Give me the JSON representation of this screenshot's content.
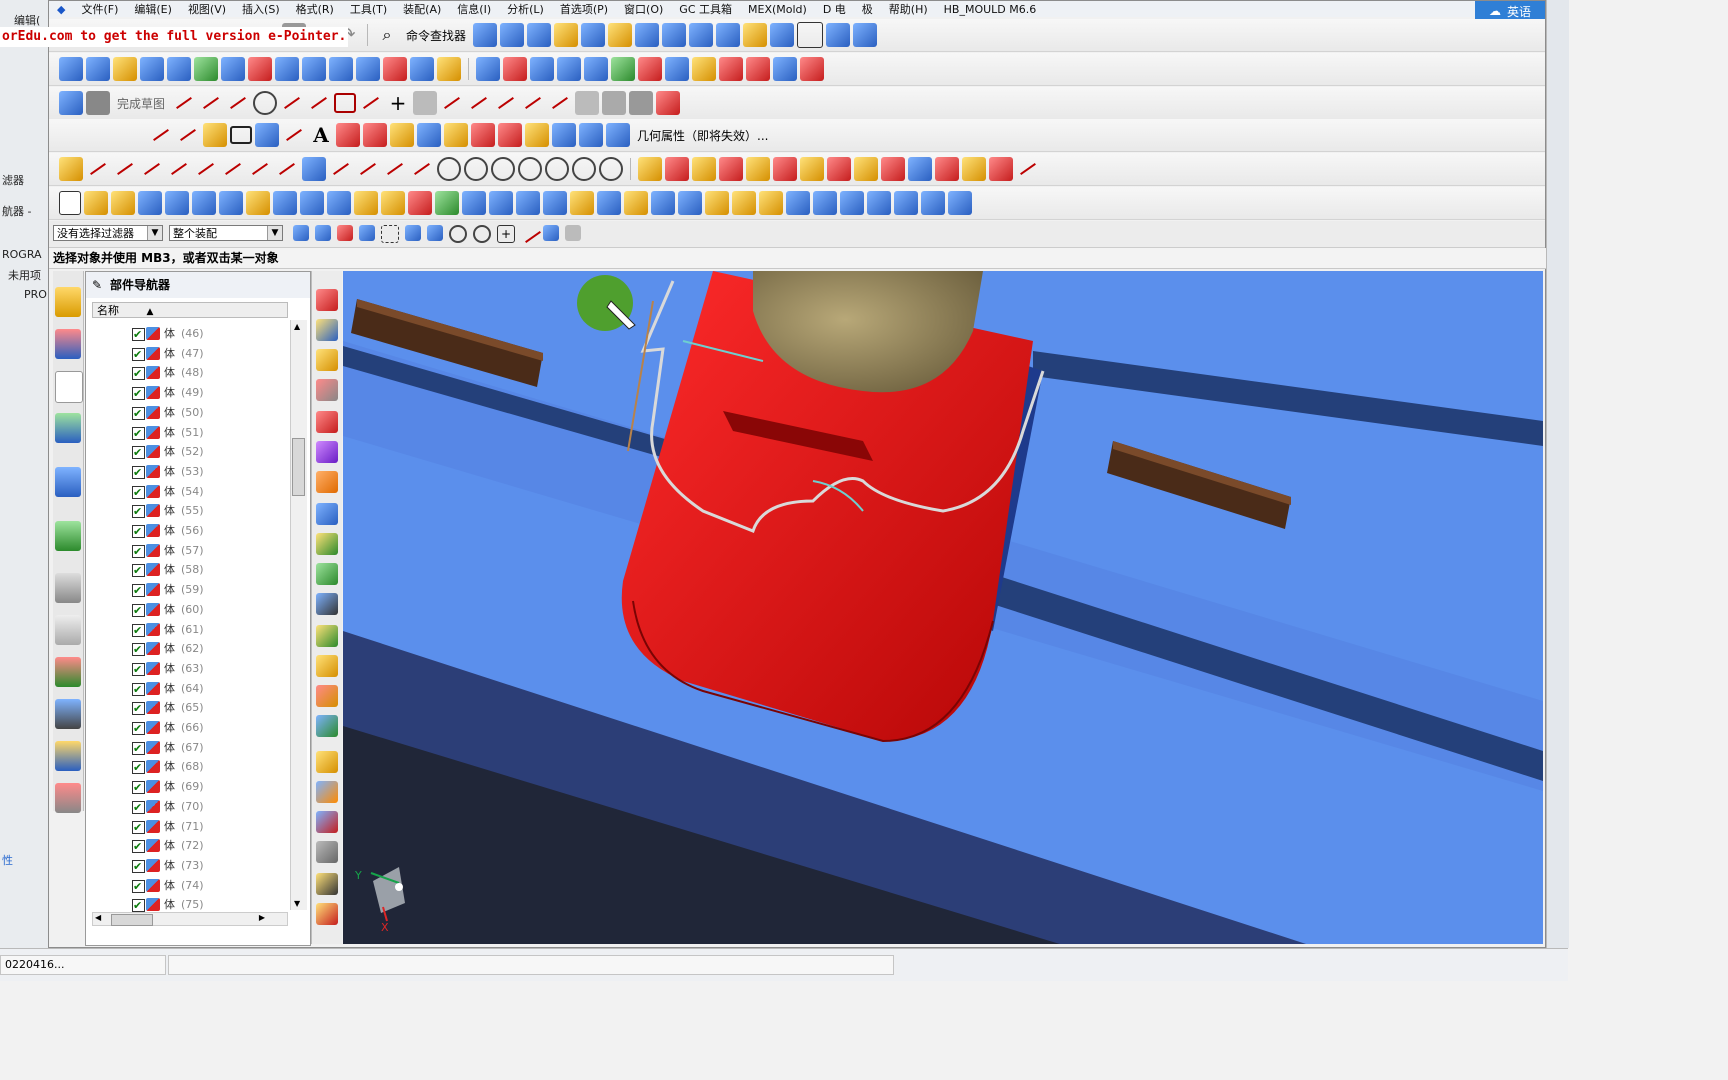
{
  "watermark": "orEdu.com to get the full version e-Pointer.",
  "bg_app": {
    "menu_fragment": "编辑(",
    "filter_fragment": "滤器",
    "nav_fragment": "航器 -",
    "program_fragment": "ROGRA",
    "unused_fragment": "未用项",
    "pro_fragment": "PRO",
    "prop_fragment": "性",
    "time_fragment": "0220416..."
  },
  "menubar": {
    "items": [
      "文件(F)",
      "编辑(E)",
      "视图(V)",
      "插入(S)",
      "格式(R)",
      "工具(T)",
      "装配(A)",
      "信息(I)",
      "分析(L)",
      "首选项(P)",
      "窗口(O)",
      "GC 工具箱",
      "MEX(Mold)",
      "D 电",
      "极",
      "帮助(H)",
      "HB_MOULD M6.6"
    ]
  },
  "cloud": {
    "label": "英语"
  },
  "toolbar": {
    "command_finder": "命令查找器",
    "finish_sketch": "完成草图",
    "geometry_props": "几何属性（即将失效）..."
  },
  "filter": {
    "selection_filter": "没有选择过滤器",
    "scope": "整个装配"
  },
  "status_text": "选择对象并使用 MB3，或者双击某一对象",
  "navigator": {
    "title": "部件导航器",
    "column_name": "名称",
    "rows": [
      {
        "label": "体",
        "num": "(46)"
      },
      {
        "label": "体",
        "num": "(47)"
      },
      {
        "label": "体",
        "num": "(48)"
      },
      {
        "label": "体",
        "num": "(49)"
      },
      {
        "label": "体",
        "num": "(50)"
      },
      {
        "label": "体",
        "num": "(51)"
      },
      {
        "label": "体",
        "num": "(52)"
      },
      {
        "label": "体",
        "num": "(53)"
      },
      {
        "label": "体",
        "num": "(54)"
      },
      {
        "label": "体",
        "num": "(55)"
      },
      {
        "label": "体",
        "num": "(56)"
      },
      {
        "label": "体",
        "num": "(57)"
      },
      {
        "label": "体",
        "num": "(58)"
      },
      {
        "label": "体",
        "num": "(59)"
      },
      {
        "label": "体",
        "num": "(60)"
      },
      {
        "label": "体",
        "num": "(61)"
      },
      {
        "label": "体",
        "num": "(62)"
      },
      {
        "label": "体",
        "num": "(63)"
      },
      {
        "label": "体",
        "num": "(64)"
      },
      {
        "label": "体",
        "num": "(65)"
      },
      {
        "label": "体",
        "num": "(66)"
      },
      {
        "label": "体",
        "num": "(67)"
      },
      {
        "label": "体",
        "num": "(68)"
      },
      {
        "label": "体",
        "num": "(69)"
      },
      {
        "label": "体",
        "num": "(70)"
      },
      {
        "label": "体",
        "num": "(71)"
      },
      {
        "label": "体",
        "num": "(72)"
      },
      {
        "label": "体",
        "num": "(73)"
      },
      {
        "label": "体",
        "num": "(74)"
      },
      {
        "label": "体",
        "num": "(75)"
      }
    ]
  },
  "triad": {
    "x": "X",
    "y": "Y"
  },
  "colors": {
    "viewport_blue": "#5a8fe8",
    "part_red": "#e01414",
    "accent": "#2f7fd6"
  }
}
